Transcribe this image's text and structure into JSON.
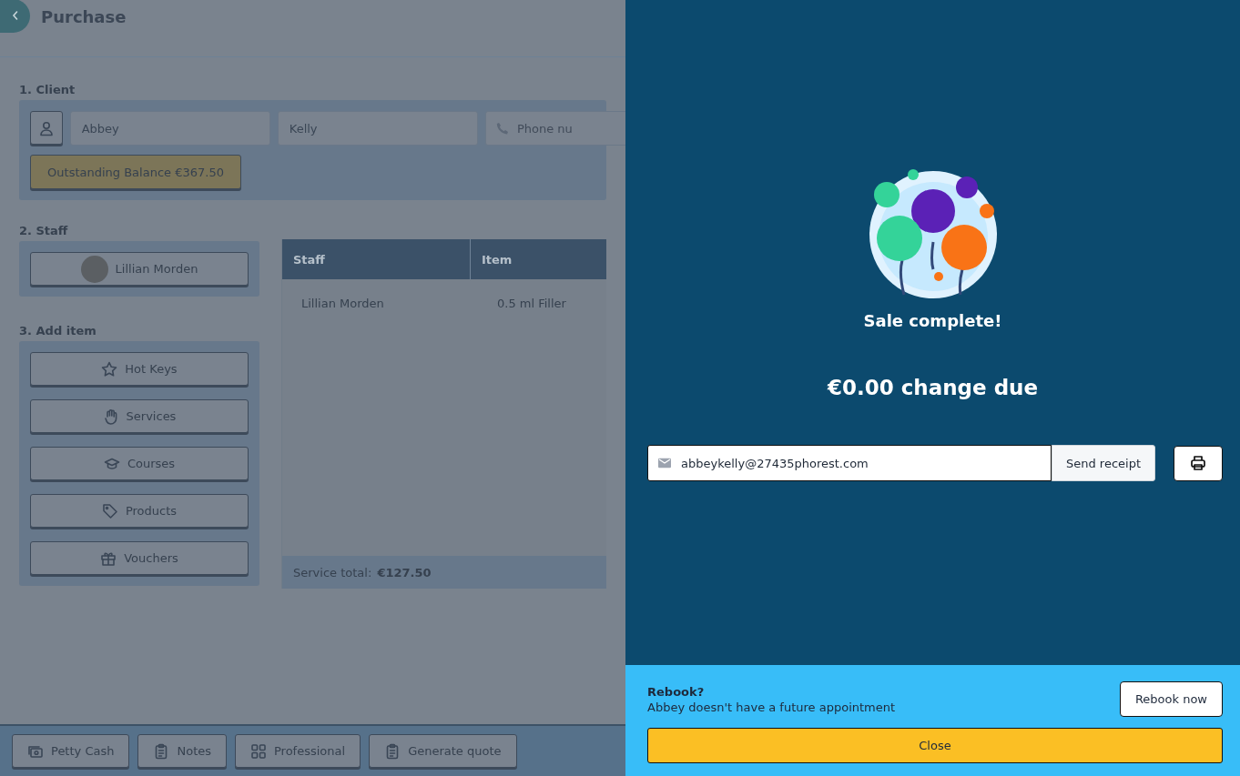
{
  "header": {
    "title": "Purchase"
  },
  "client": {
    "section_label": "1. Client",
    "first_name": "Abbey",
    "last_name": "Kelly",
    "phone_placeholder": "Phone nu",
    "balance": "Outstanding Balance €367.50"
  },
  "staff": {
    "section_label": "2. Staff",
    "member": "Lillian Morden"
  },
  "add_item": {
    "section_label": "3. Add item",
    "buttons": [
      {
        "label": "Hot Keys",
        "kind": "star"
      },
      {
        "label": "Services",
        "kind": "hand"
      },
      {
        "label": "Courses",
        "kind": "cap"
      },
      {
        "label": "Products",
        "kind": "tag"
      },
      {
        "label": "Vouchers",
        "kind": "gift"
      }
    ]
  },
  "table": {
    "columns": [
      "Staff",
      "Item"
    ],
    "rows": [
      {
        "cells": [
          "Lillian Morden",
          "0.5 ml Filler"
        ]
      }
    ],
    "total_label": "Service total:",
    "total_value": "€127.50"
  },
  "footer_buttons": [
    {
      "label": "Petty Cash",
      "kind": "cash"
    },
    {
      "label": "Notes",
      "kind": "clipboard"
    },
    {
      "label": "Professional",
      "kind": "grid"
    },
    {
      "label": "Generate quote",
      "kind": "clipboard"
    }
  ],
  "sale_panel": {
    "title": "Sale complete!",
    "change_due": "€0.00 change due",
    "email": "abbeykelly@27435phorest.com",
    "send_button": "Send receipt",
    "rebook": {
      "title": "Rebook?",
      "message": "Abbey doesn't have a future appointment",
      "button": "Rebook now"
    },
    "close_button": "Close"
  }
}
